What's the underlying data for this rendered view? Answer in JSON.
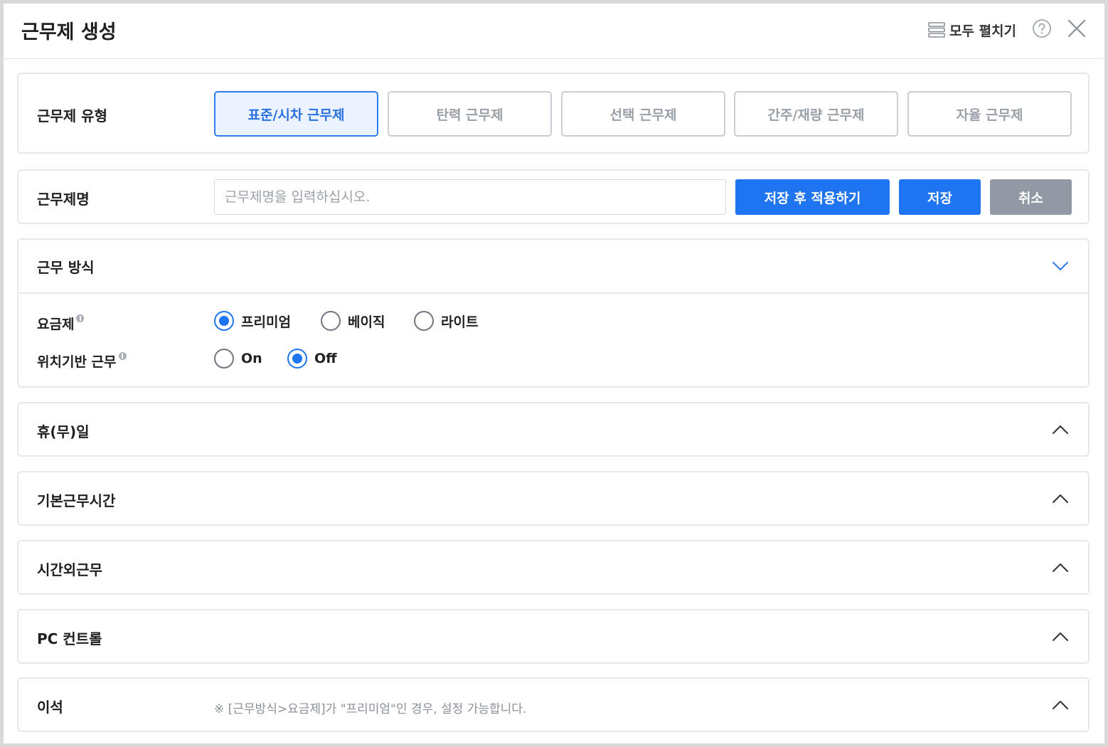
{
  "header": {
    "title": "근무제 생성",
    "expand_all_label": "모두 펼치기"
  },
  "work_type": {
    "label": "근무제 유형",
    "options": [
      "표준/시차 근무제",
      "탄력 근무제",
      "선택 근무제",
      "간주/재량 근무제",
      "자율 근무제"
    ],
    "selected": "표준/시차 근무제"
  },
  "work_name": {
    "label": "근무제명",
    "value": "",
    "placeholder": "근무제명을 입력하십시오.",
    "save_apply_label": "저장 후 적용하기",
    "save_label": "저장",
    "cancel_label": "취소"
  },
  "work_method": {
    "title": "근무 방식",
    "plan": {
      "label": "요금제",
      "options": [
        "프리미엄",
        "베이직",
        "라이트"
      ],
      "selected": "프리미엄"
    },
    "location": {
      "label": "위치기반 근무",
      "options": [
        "On",
        "Off"
      ],
      "selected": "Off"
    }
  },
  "sections": {
    "holiday": "휴(무)일",
    "basic_hours": "기본근무시간",
    "overtime": "시간외근무",
    "pc_control": "PC 컨트롤",
    "away": "이석",
    "away_note": "※ [근무방식>요금제]가 \"프리미엄\"인 경우, 설정 가능합니다."
  },
  "colors": {
    "accent": "#1f74f0",
    "active_bg": "#eaf3ff",
    "cancel_gray": "#9099a4",
    "border": "#e5e8ee"
  }
}
